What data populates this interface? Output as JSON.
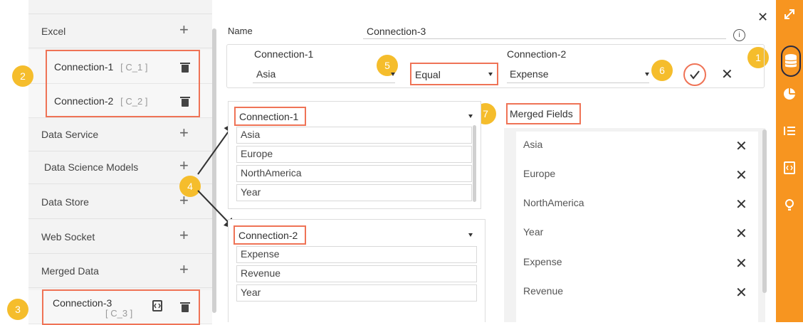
{
  "left_panel": {
    "sections": [
      {
        "label": "Excel"
      },
      {
        "label": "Data Service"
      },
      {
        "label": "Data Science Models"
      },
      {
        "label": "Data Store"
      },
      {
        "label": "Web Socket"
      },
      {
        "label": "Merged Data"
      }
    ],
    "excel_connections": [
      {
        "name": "Connection-1",
        "code": "[ C_1 ]"
      },
      {
        "name": "Connection-2",
        "code": "[ C_2 ]"
      }
    ],
    "merged_connection": {
      "name": "Connection-3",
      "code": "[ C_3 ]"
    }
  },
  "badges": [
    "1",
    "2",
    "3",
    "4",
    "5",
    "6",
    "7"
  ],
  "form": {
    "name_label": "Name",
    "name_value": "Connection-3",
    "join": {
      "left_connection": "Connection-1",
      "left_field": "Asia",
      "operator": "Equal",
      "right_connection": "Connection-2",
      "right_field": "Expense"
    }
  },
  "connection_lists": [
    {
      "select": "Connection-1",
      "fields": [
        "Asia",
        "Europe",
        "NorthAmerica",
        "Year"
      ]
    },
    {
      "select": "Connection-2",
      "fields": [
        "Expense",
        "Revenue",
        "Year"
      ]
    }
  ],
  "merged_fields": {
    "title": "Merged Fields",
    "items": [
      "Asia",
      "Europe",
      "NorthAmerica",
      "Year",
      "Expense",
      "Revenue"
    ]
  },
  "colors": {
    "accent": "#f79520",
    "highlight": "#ef7356",
    "badge": "#f5bd2c"
  },
  "icons": [
    "close-icon",
    "info-icon",
    "expand-icon",
    "database-icon",
    "pie-chart-icon",
    "list-icon",
    "code-icon",
    "bulb-icon",
    "trash-icon",
    "check-icon",
    "plus-icon"
  ]
}
